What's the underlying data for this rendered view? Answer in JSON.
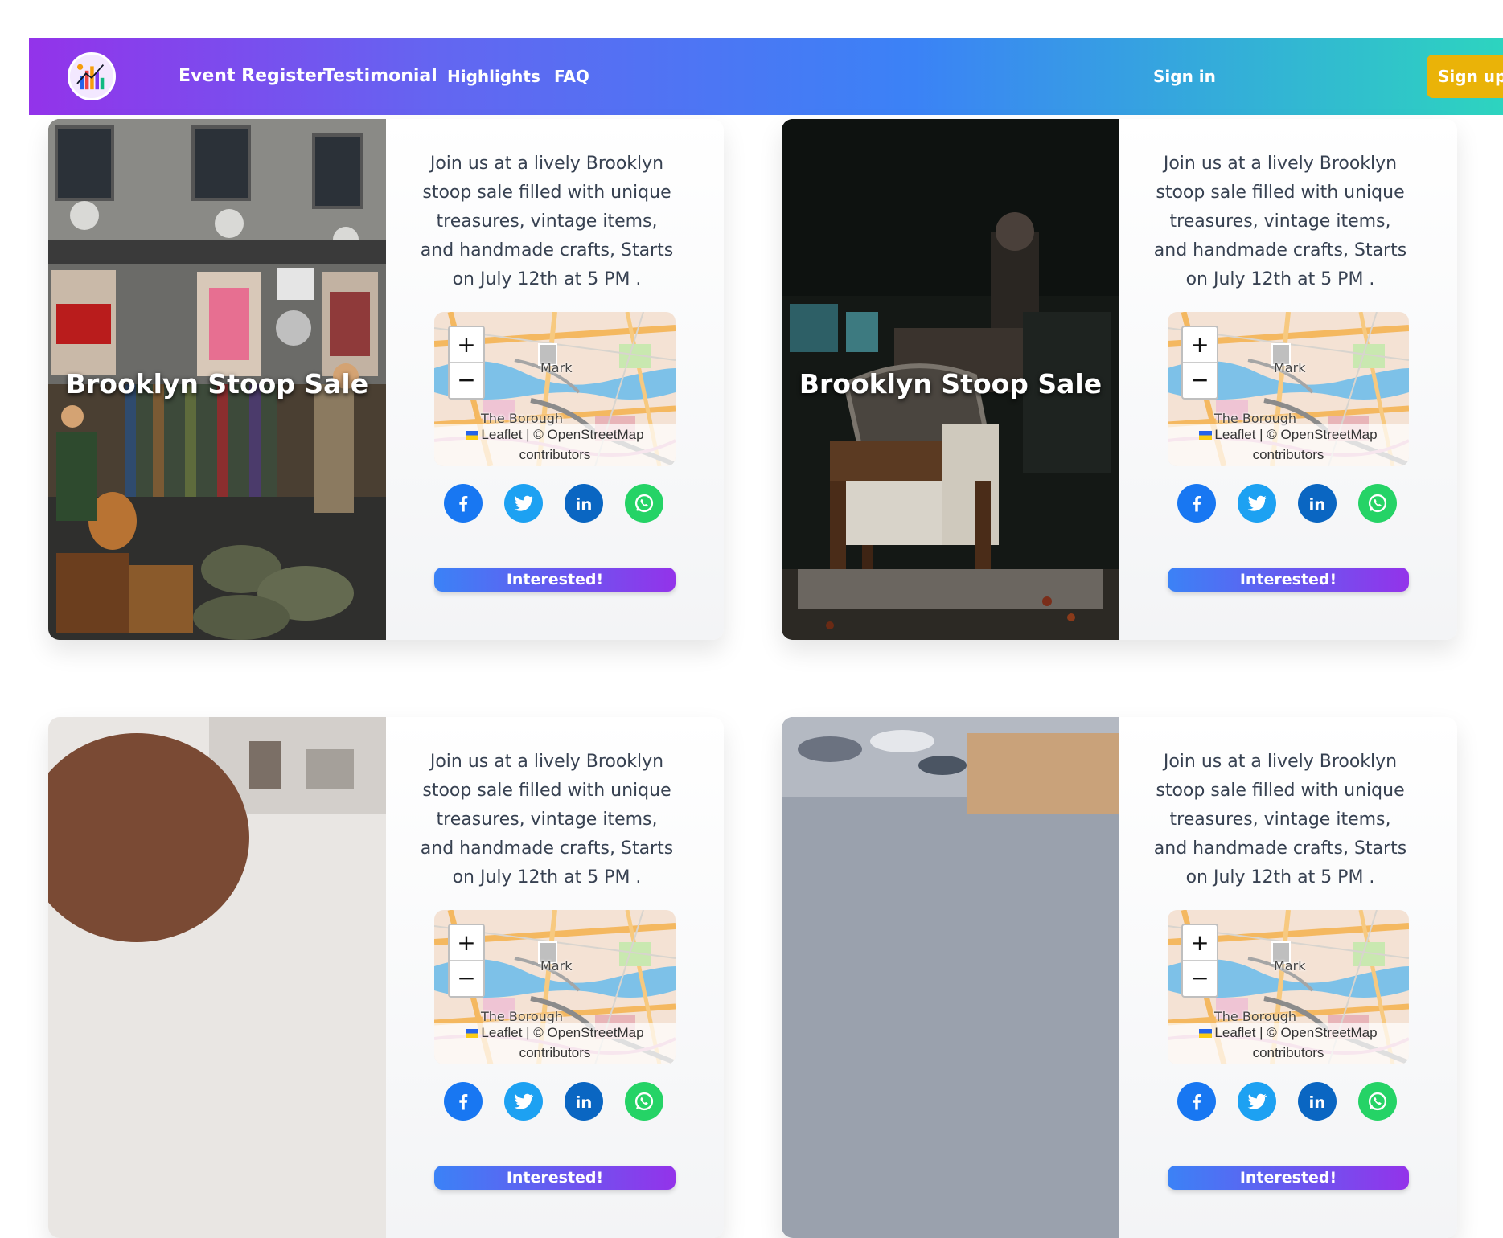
{
  "nav": {
    "links": [
      "Event Register",
      "Testimonial",
      "Highlights",
      "FAQ"
    ],
    "sign_in": "Sign in",
    "sign_up": "Sign up"
  },
  "cards": [
    {
      "title": "Brooklyn Stoop Sale",
      "description": "Join us at a lively Brooklyn stoop sale filled with unique treasures, vintage items, and handmade crafts, Starts on July 12th at 5 PM .",
      "map": {
        "zoom_in": "+",
        "zoom_out": "−",
        "label_1": "Mark",
        "label_2": "The Borough",
        "attribution": "Leaflet | © OpenStreetMap contributors"
      },
      "button": "Interested!"
    },
    {
      "title": "Brooklyn Stoop Sale",
      "description": "Join us at a lively Brooklyn stoop sale filled with unique treasures, vintage items, and handmade crafts, Starts on July 12th at 5 PM .",
      "map": {
        "zoom_in": "+",
        "zoom_out": "−",
        "label_1": "Mark",
        "label_2": "The Borough",
        "attribution": "Leaflet | © OpenStreetMap contributors"
      },
      "button": "Interested!"
    },
    {
      "title": "",
      "description": "Join us at a lively Brooklyn stoop sale filled with unique treasures, vintage items, and handmade crafts, Starts on July 12th at 5 PM .",
      "map": {
        "zoom_in": "+",
        "zoom_out": "−",
        "label_1": "Mark",
        "label_2": "The Borough",
        "attribution": "Leaflet | © OpenStreetMap contributors"
      },
      "button": "Interested!"
    },
    {
      "title": "",
      "description": "Join us at a lively Brooklyn stoop sale filled with unique treasures, vintage items, and handmade crafts, Starts on July 12th at 5 PM .",
      "map": {
        "zoom_in": "+",
        "zoom_out": "−",
        "label_1": "Mark",
        "label_2": "The Borough",
        "attribution": "Leaflet | © OpenStreetMap contributors"
      },
      "button": "Interested!"
    }
  ],
  "social_icons": [
    "facebook-icon",
    "twitter-icon",
    "linkedin-icon",
    "whatsapp-icon"
  ],
  "colors": {
    "nav_gradient": [
      "#9333ea",
      "#3b82f6",
      "#2dd4bf"
    ],
    "sign_up_bg": "#eab308",
    "facebook": "#1877f2",
    "twitter": "#1da1f2",
    "linkedin": "#0a66c2",
    "whatsapp": "#25d366"
  }
}
